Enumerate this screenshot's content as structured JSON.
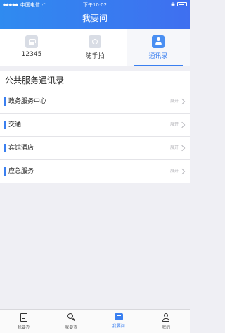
{
  "status": {
    "carrier": "中国电信",
    "time": "下午10:02"
  },
  "header": {
    "title": "我要问"
  },
  "tabs": [
    {
      "label": "12345",
      "icon": "phone-icon"
    },
    {
      "label": "随手拍",
      "icon": "camera-icon"
    },
    {
      "label": "通讯录",
      "icon": "contacts-icon",
      "active": true
    }
  ],
  "section": {
    "title": "公共服务通讯录"
  },
  "list": [
    {
      "label": "政务服务中心",
      "expand": "展开"
    },
    {
      "label": "交通",
      "expand": "展开"
    },
    {
      "label": "宾馆酒店",
      "expand": "展开"
    },
    {
      "label": "应急服务",
      "expand": "展开"
    }
  ],
  "bottom_nav": [
    {
      "label": "我要办",
      "icon": "document-icon"
    },
    {
      "label": "我要查",
      "icon": "search-icon"
    },
    {
      "label": "我要问",
      "icon": "chat-icon",
      "active": true
    },
    {
      "label": "我的",
      "icon": "user-icon"
    }
  ],
  "colors": {
    "accent": "#3a7ff0",
    "header_start": "#2f8bf0",
    "header_end": "#3f6ff0"
  }
}
